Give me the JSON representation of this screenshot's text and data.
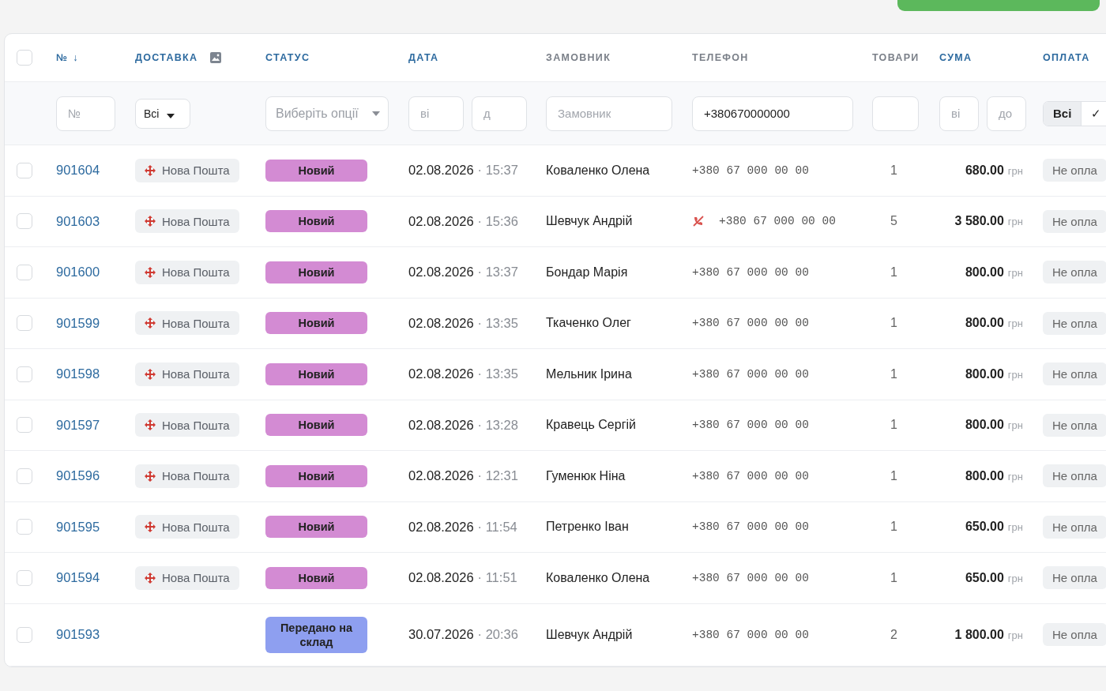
{
  "header": {
    "checked": false,
    "columns": [
      {
        "label": "№",
        "sortable": true,
        "sort_arrow": "↓"
      },
      {
        "label": "ДОСТАВКА",
        "sortable": true,
        "image_icon": true
      },
      {
        "label": "СТАТУС",
        "sortable": true
      },
      {
        "label": "ДАТА",
        "sortable": true
      },
      {
        "label": "ЗАМОВНИК",
        "sortable": false
      },
      {
        "label": "ТЕЛЕФОН",
        "sortable": false
      },
      {
        "label": "ТОВАРИ",
        "sortable": false
      },
      {
        "label": "СУМА",
        "sortable": true
      },
      {
        "label": "ОПЛАТА",
        "sortable": true
      }
    ]
  },
  "filters": {
    "number": {
      "placeholder": "№"
    },
    "delivery": {
      "value": "Всі"
    },
    "status": {
      "placeholder": "Виберіть опції"
    },
    "date_from": {
      "placeholder": "ві"
    },
    "date_to": {
      "placeholder": "д"
    },
    "customer": {
      "placeholder": "Замовник"
    },
    "phone": {
      "value": "+380670000000"
    },
    "sum_from": {
      "placeholder": "ві"
    },
    "sum_to": {
      "placeholder": "до"
    },
    "payment": [
      {
        "label": "Всі",
        "selected": true
      },
      {
        "label": "✓",
        "selected": false
      }
    ]
  },
  "rows": [
    {
      "checked": false,
      "number": "901604",
      "delivery": "Нова Пошта",
      "status": "Новий",
      "color": "#d38bd3",
      "date": "02.08.2026",
      "time": "· 15:37",
      "customer": "Коваленко Олена",
      "phone_flag": false,
      "phone": "+380 67 000 00 00",
      "goods": "1",
      "sum": "680.00",
      "currency": "грн",
      "payment": "Не опла"
    },
    {
      "checked": false,
      "number": "901603",
      "delivery": "Нова Пошта",
      "status": "Новий",
      "color": "#d38bd3",
      "date": "02.08.2026",
      "time": "· 15:36",
      "customer": "Шевчук Андрій",
      "phone_flag": true,
      "phone": "+380 67 000 00 00",
      "goods": "5",
      "sum": "3 580.00",
      "currency": "грн",
      "payment": "Не опла"
    },
    {
      "checked": false,
      "number": "901600",
      "delivery": "Нова Пошта",
      "status": "Новий",
      "color": "#d38bd3",
      "date": "02.08.2026",
      "time": "· 13:37",
      "customer": "Бондар Марія",
      "phone_flag": false,
      "phone": "+380 67 000 00 00",
      "goods": "1",
      "sum": "800.00",
      "currency": "грн",
      "payment": "Не опла"
    },
    {
      "checked": false,
      "number": "901599",
      "delivery": "Нова Пошта",
      "status": "Новий",
      "color": "#d38bd3",
      "date": "02.08.2026",
      "time": "· 13:35",
      "customer": "Ткаченко Олег",
      "phone_flag": false,
      "phone": "+380 67 000 00 00",
      "goods": "1",
      "sum": "800.00",
      "currency": "грн",
      "payment": "Не опла"
    },
    {
      "checked": false,
      "number": "901598",
      "delivery": "Нова Пошта",
      "status": "Новий",
      "color": "#d38bd3",
      "date": "02.08.2026",
      "time": "· 13:35",
      "customer": "Мельник Ірина",
      "phone_flag": false,
      "phone": "+380 67 000 00 00",
      "goods": "1",
      "sum": "800.00",
      "currency": "грн",
      "payment": "Не опла"
    },
    {
      "checked": false,
      "number": "901597",
      "delivery": "Нова Пошта",
      "status": "Новий",
      "color": "#d38bd3",
      "date": "02.08.2026",
      "time": "· 13:28",
      "customer": "Кравець Сергій",
      "phone_flag": false,
      "phone": "+380 67 000 00 00",
      "goods": "1",
      "sum": "800.00",
      "currency": "грн",
      "payment": "Не опла"
    },
    {
      "checked": false,
      "number": "901596",
      "delivery": "Нова Пошта",
      "status": "Новий",
      "color": "#d38bd3",
      "date": "02.08.2026",
      "time": "· 12:31",
      "customer": "Гуменюк Ніна",
      "phone_flag": false,
      "phone": "+380 67 000 00 00",
      "goods": "1",
      "sum": "800.00",
      "currency": "грн",
      "payment": "Не опла"
    },
    {
      "checked": false,
      "number": "901595",
      "delivery": "Нова Пошта",
      "status": "Новий",
      "color": "#d38bd3",
      "date": "02.08.2026",
      "time": "· 11:54",
      "customer": "Петренко Іван",
      "phone_flag": false,
      "phone": "+380 67 000 00 00",
      "goods": "1",
      "sum": "650.00",
      "currency": "грн",
      "payment": "Не опла"
    },
    {
      "checked": false,
      "number": "901594",
      "delivery": "Нова Пошта",
      "status": "Новий",
      "color": "#d38bd3",
      "date": "02.08.2026",
      "time": "· 11:51",
      "customer": "Коваленко Олена",
      "phone_flag": false,
      "phone": "+380 67 000 00 00",
      "goods": "1",
      "sum": "650.00",
      "currency": "грн",
      "payment": "Не опла"
    },
    {
      "checked": false,
      "number": "901593",
      "status": "Передано на склад",
      "color": "#8e9ff0",
      "date": "30.07.2026",
      "time": "· 20:36",
      "customer": "Шевчук Андрій",
      "phone_flag": false,
      "phone": "+380 67 000 00 00",
      "goods": "2",
      "sum": "1 800.00",
      "currency": "грн",
      "payment": "Не опла"
    }
  ]
}
